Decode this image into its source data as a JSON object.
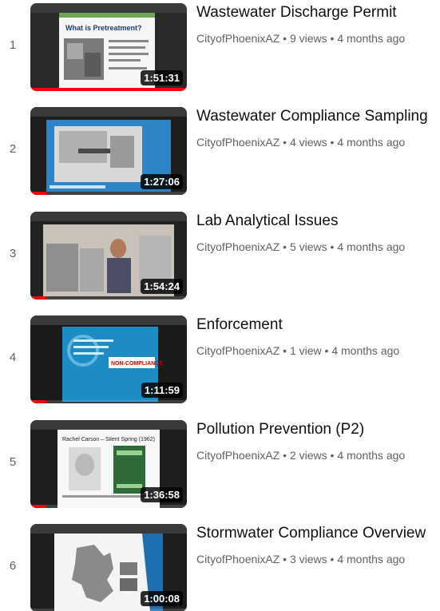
{
  "playlist": {
    "videos": [
      {
        "index": "1",
        "title": "Wastewater Discharge Permit",
        "channel": "CityofPhoenixAZ",
        "views": "9 views",
        "age": "4 months ago",
        "duration": "1:51:31",
        "thumbnail_text": "What is Pretreatment?",
        "watched_fraction": 1.0
      },
      {
        "index": "2",
        "title": "Wastewater Compliance Sampling",
        "channel": "CityofPhoenixAZ",
        "views": "4 views",
        "age": "4 months ago",
        "duration": "1:27:06",
        "thumbnail_text": "",
        "watched_fraction": 0.1
      },
      {
        "index": "3",
        "title": "Lab Analytical Issues",
        "channel": "CityofPhoenixAZ",
        "views": "5 views",
        "age": "4 months ago",
        "duration": "1:54:24",
        "thumbnail_text": "",
        "watched_fraction": 0.1
      },
      {
        "index": "4",
        "title": "Enforcement",
        "channel": "CityofPhoenixAZ",
        "views": "1 view",
        "age": "4 months ago",
        "duration": "1:11:59",
        "thumbnail_text": "NON-COMPLIANCE",
        "watched_fraction": 0.1
      },
      {
        "index": "5",
        "title": "Pollution Prevention (P2)",
        "channel": "CityofPhoenixAZ",
        "views": "2 views",
        "age": "4 months ago",
        "duration": "1:36:58",
        "thumbnail_text": "Rachel Carson – Silent Spring (1962)",
        "watched_fraction": 0.1
      },
      {
        "index": "6",
        "title": "Stormwater Compliance Overview",
        "channel": "CityofPhoenixAZ",
        "views": "3 views",
        "age": "4 months ago",
        "duration": "1:00:08",
        "thumbnail_text": "",
        "watched_fraction": 0.0
      }
    ]
  },
  "colors": {
    "progress": "#ff0000",
    "meta_text": "#606060",
    "title_text": "#0f0f0f"
  }
}
